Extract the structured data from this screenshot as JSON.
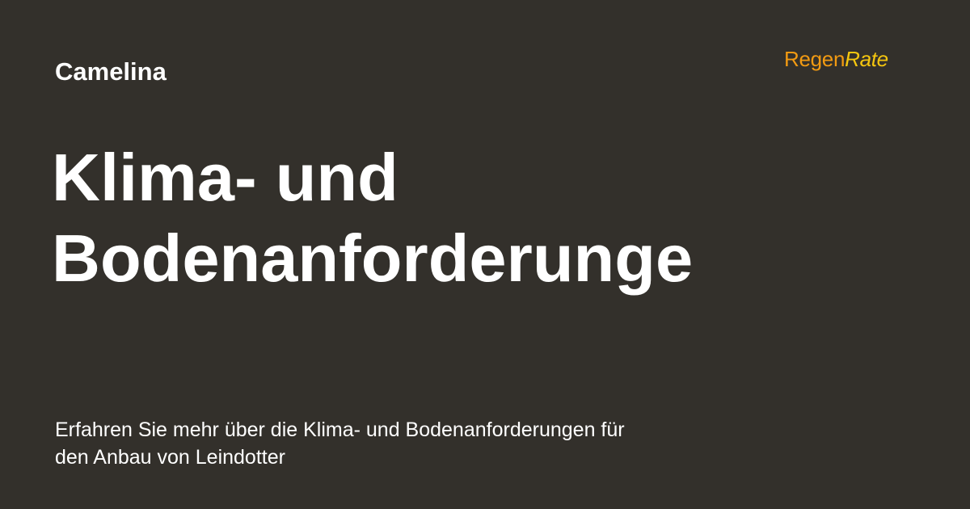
{
  "category": "Camelina",
  "logo": {
    "part1": "Regen",
    "part2": "Rate"
  },
  "title": {
    "line1": "Klima- und",
    "line2": "Bodenanforderunge"
  },
  "description": {
    "line1": "Erfahren Sie mehr über die Klima- und Bodenanforderungen für",
    "line2": "den Anbau von Leindotter"
  },
  "colors": {
    "background": "#33302b",
    "text": "#ffffff",
    "logo_regen": "#f29a12",
    "logo_rate": "#f5c60f"
  }
}
